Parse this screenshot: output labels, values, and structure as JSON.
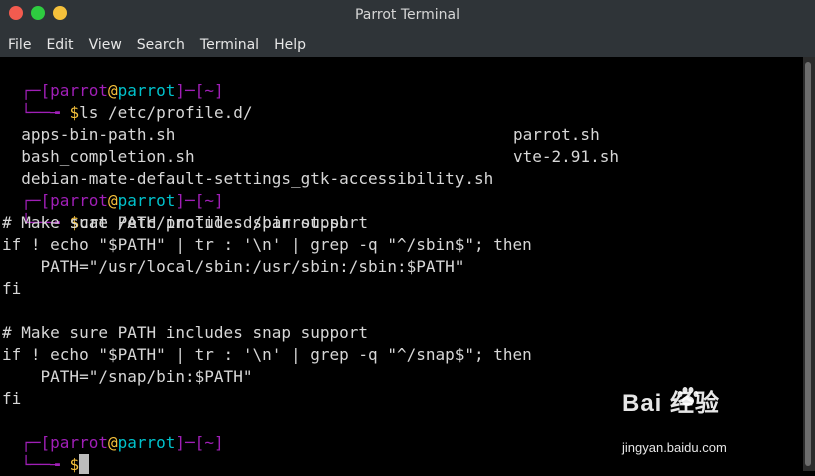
{
  "window": {
    "title": "Parrot Terminal"
  },
  "menubar": {
    "items": [
      "File",
      "Edit",
      "View",
      "Search",
      "Terminal",
      "Help"
    ]
  },
  "terminal": {
    "prompt": {
      "open": "┌─[",
      "user": "parrot",
      "at": "@",
      "host": "parrot",
      "sep": "]─[",
      "dir": "~",
      "close": "]",
      "corner": "└──╼ ",
      "dollar": "$"
    },
    "commands": [
      "ls /etc/profile.d/",
      "cat /etc/profile.d/parrot.sh"
    ],
    "ls_output": {
      "left": [
        "apps-bin-path.sh",
        "bash_completion.sh",
        "debian-mate-default-settings_gtk-accessibility.sh"
      ],
      "right": [
        "parrot.sh",
        "vte-2.91.sh"
      ]
    },
    "cat_output": [
      "# Make sure PATH includes sbin support",
      "if ! echo \"$PATH\" | tr : '\\n' | grep -q \"^/sbin$\"; then",
      "    PATH=\"/usr/local/sbin:/usr/sbin:/sbin:$PATH\"",
      "fi",
      "",
      "# Make sure PATH includes snap support",
      "if ! echo \"$PATH\" | tr : '\\n' | grep -q \"^/snap$\"; then",
      "    PATH=\"/snap/bin:$PATH\"",
      "fi"
    ]
  },
  "watermark": {
    "logo": "Bai 经验",
    "url": "jingyan.baidu.com"
  }
}
